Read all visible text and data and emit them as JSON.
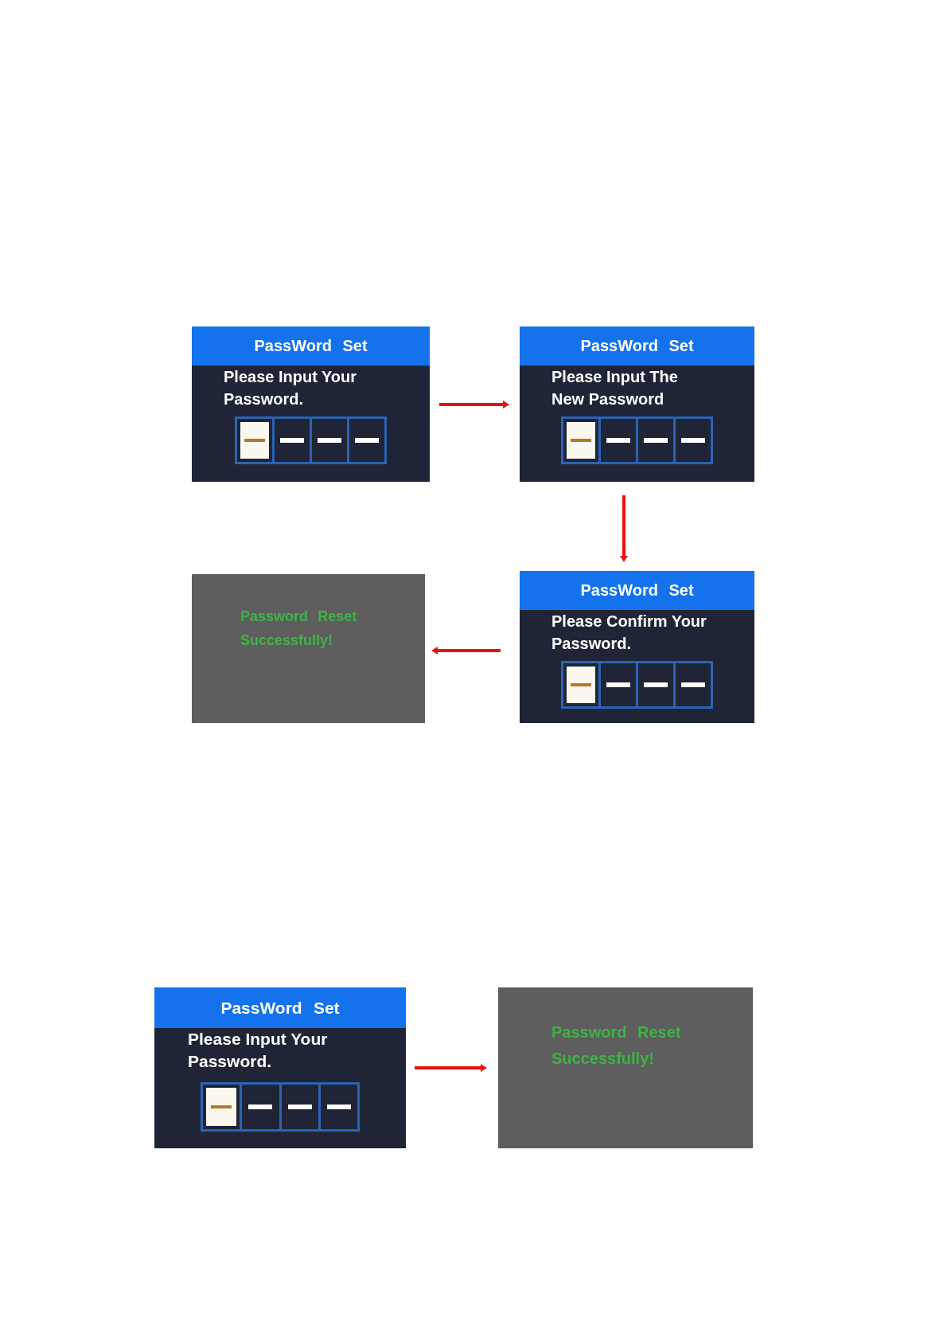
{
  "flows": [
    {
      "kind": "square",
      "rows": [
        {
          "screens": [
            {
              "kind": "entry",
              "title": "PassWord Set",
              "prompt": "Please Input Your\nPassword.",
              "slots": [
                {
                  "selected": true
                },
                {
                  "selected": false
                },
                {
                  "selected": false
                },
                {
                  "selected": false
                }
              ]
            },
            {
              "kind": "entry",
              "title": "PassWord Set",
              "prompt": "Please Input The\nNew Password",
              "slots": [
                {
                  "selected": true
                },
                {
                  "selected": false
                },
                {
                  "selected": false
                },
                {
                  "selected": false
                }
              ]
            }
          ]
        },
        {
          "screens": [
            {
              "kind": "message",
              "message": "Password Reset\nSuccessfully!"
            },
            {
              "kind": "entry",
              "title": "PassWord Set",
              "prompt": "Please Confirm Your\nPassword.",
              "slots": [
                {
                  "selected": true
                },
                {
                  "selected": false
                },
                {
                  "selected": false
                },
                {
                  "selected": false
                }
              ]
            }
          ]
        }
      ]
    },
    {
      "kind": "row",
      "rows": [
        {
          "screens": [
            {
              "kind": "entry",
              "title": "PassWord Set",
              "prompt": "Please Input Your\nPassword.",
              "slots": [
                {
                  "selected": true
                },
                {
                  "selected": false
                },
                {
                  "selected": false
                },
                {
                  "selected": false
                }
              ]
            },
            {
              "kind": "message",
              "message": "Password Reset\nSuccessfully!"
            }
          ]
        }
      ]
    }
  ]
}
